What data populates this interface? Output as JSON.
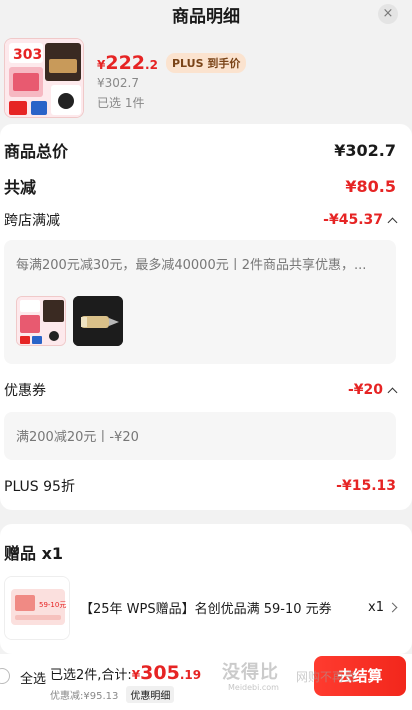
{
  "header": {
    "title": "商品明细",
    "close": "×"
  },
  "product": {
    "price_symbol": "¥",
    "price_int": "222",
    "price_dec": ".2",
    "plus_tag": "PLUS 到手价",
    "original_price": "¥302.7",
    "selected": "已选 1件",
    "thumb_text": "303"
  },
  "summary": {
    "total_label": "商品总价",
    "total_value": "¥302.7",
    "discount_label": "共减",
    "discount_value": "¥80.5"
  },
  "cross_store": {
    "label": "跨店满减",
    "value": "-¥45.37",
    "desc": "每满200元减30元，最多减40000元丨2件商品共享优惠，..."
  },
  "coupon": {
    "label": "优惠券",
    "value": "-¥20",
    "desc": "满200减20元丨-¥20"
  },
  "plus": {
    "label": "PLUS 95折",
    "value": "-¥15.13"
  },
  "gift": {
    "title": "赠品 x1",
    "name": "【25年 WPS赠品】名创优品满 59-10 元券",
    "qty": "x1",
    "thumb_text": "59-10元"
  },
  "bottom": {
    "select_all": "全选",
    "total_prefix": "已选2件,合计:",
    "total_symbol": "¥",
    "total_int": "305",
    "total_dec": ".19",
    "discount_text": "优惠减:¥95.13",
    "detail_chip": "优惠明细",
    "checkout": "去结算"
  },
  "watermark": {
    "main": "没得比",
    "sub": "Meidebi.com",
    "right": "网购不再贵"
  },
  "colors": {
    "accent": "#e62424",
    "plus_tag_bg": "#fbe3cf",
    "checkout_bg": "#f2271c"
  }
}
